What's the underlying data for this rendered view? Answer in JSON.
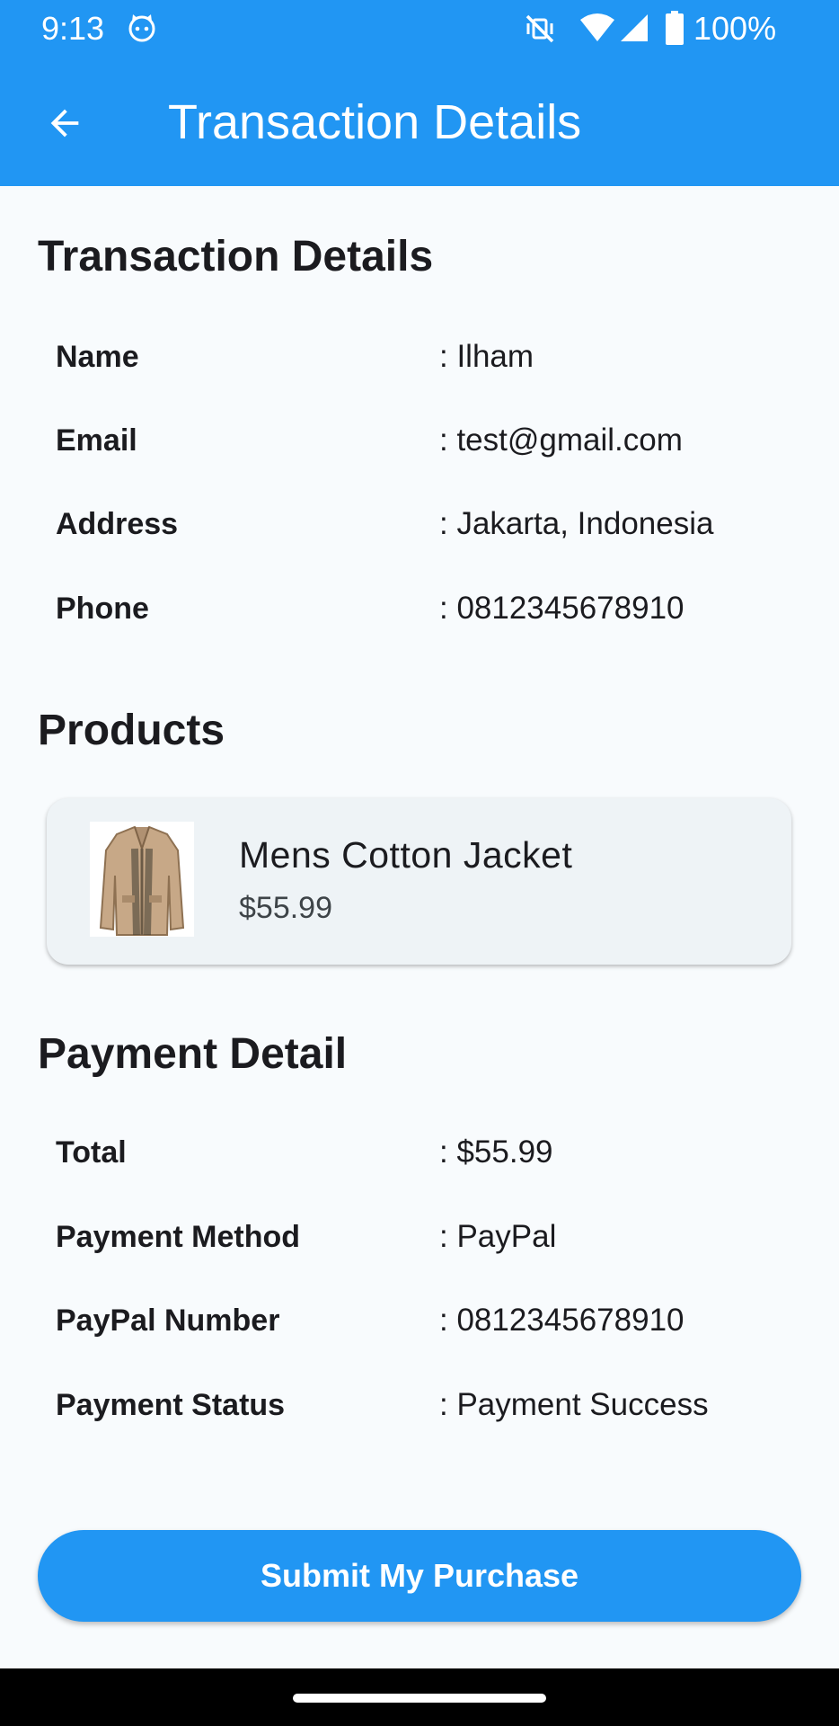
{
  "colors": {
    "primary": "#2196f3",
    "background": "#f8fbfd",
    "card": "#eef3f6",
    "text": "#1b1b1f"
  },
  "status_bar": {
    "time": "9:13",
    "battery": "100%",
    "icons": [
      "cat-face-icon",
      "vibrate-off-icon",
      "wifi-icon",
      "cellular-signal-icon",
      "battery-icon"
    ]
  },
  "app_bar": {
    "back_icon": "arrow-back-icon",
    "title": "Transaction Details"
  },
  "transaction": {
    "title": "Transaction Details",
    "rows": [
      {
        "label": "Name",
        "value": ": Ilham"
      },
      {
        "label": "Email",
        "value": ": test@gmail.com"
      },
      {
        "label": "Address",
        "value": ": Jakarta, Indonesia"
      },
      {
        "label": "Phone",
        "value": ": 0812345678910"
      }
    ]
  },
  "products": {
    "title": "Products",
    "items": [
      {
        "name": "Mens Cotton Jacket",
        "price": "$55.99",
        "image_icon": "jacket-image"
      }
    ]
  },
  "payment": {
    "title": "Payment Detail",
    "rows": [
      {
        "label": "Total",
        "value": ": $55.99"
      },
      {
        "label": "Payment Method",
        "value": ": PayPal"
      },
      {
        "label": "PayPal Number",
        "value": ": 0812345678910"
      },
      {
        "label": "Payment Status",
        "value": ": Payment Success"
      }
    ]
  },
  "actions": {
    "submit_label": "Submit My Purchase"
  }
}
